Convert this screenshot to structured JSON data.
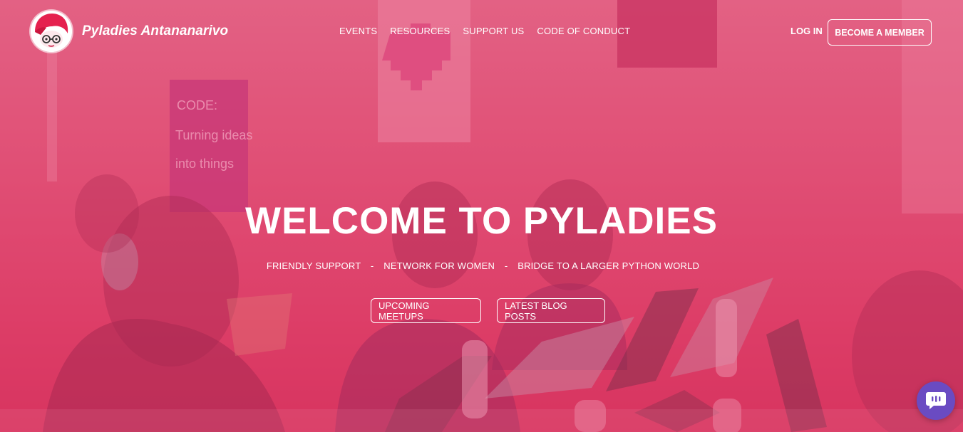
{
  "header": {
    "brand": "Pyladies Antananarivo",
    "nav": [
      "EVENTS",
      "RESOURCES",
      "SUPPORT US",
      "CODE OF CONDUCT"
    ],
    "login": "LOG IN",
    "become_member": "BECOME A MEMBER"
  },
  "hero": {
    "headline": "WELCOME TO PYLADIES",
    "tagline": [
      "FRIENDLY SUPPORT",
      "NETWORK FOR WOMEN",
      "BRIDGE TO A LARGER PYTHON WORLD"
    ],
    "separator": "-",
    "cta_upcoming": "UPCOMING MEETUPS",
    "cta_blog": "LATEST BLOG POSTS"
  },
  "background_poster": {
    "lines": [
      "CODE:",
      "Turning ideas",
      "into things"
    ]
  },
  "colors": {
    "overlay": "#e04a72",
    "chat_widget": "#6a4bc2",
    "text": "#ffffff"
  },
  "icons": {
    "logo": "pyladies-logo-icon",
    "chat": "chat-bubble-icon"
  }
}
